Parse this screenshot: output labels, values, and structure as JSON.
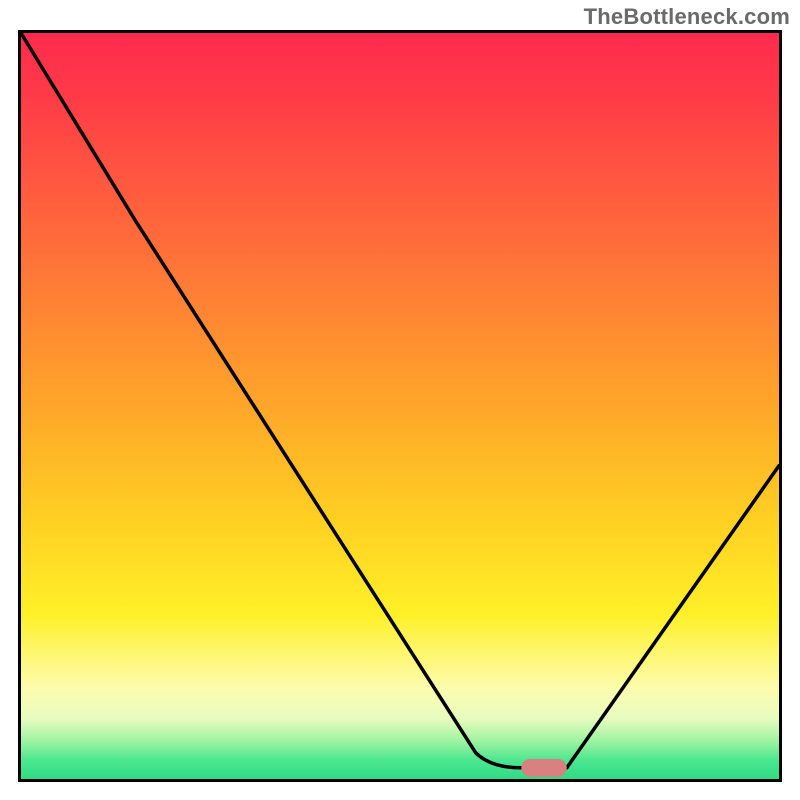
{
  "attribution": "TheBottleneck.com",
  "colors": {
    "frame": "#000000",
    "curve": "#000000",
    "pill": "#d98080",
    "gradient_stops": [
      "#ff2a4d",
      "#ff3a48",
      "#ff5840",
      "#ff7f35",
      "#ffa62a",
      "#ffcf22",
      "#fff028",
      "#fdfcb0",
      "#e6fcbf",
      "#9cf3a0",
      "#4de690",
      "#2fdb85"
    ]
  },
  "chart_data": {
    "type": "line",
    "title": "",
    "xlabel": "",
    "ylabel": "",
    "xlim": [
      0,
      100
    ],
    "ylim": [
      0,
      100
    ],
    "series": [
      {
        "name": "bottleneck-curve",
        "x": [
          0,
          15,
          60,
          66,
          72,
          100
        ],
        "values": [
          100,
          75,
          3.5,
          1.5,
          1.5,
          42
        ]
      }
    ],
    "marker": {
      "name": "optimal-region-pill",
      "x_center": 69,
      "y": 1.5,
      "width_pct": 6,
      "color": "#d98080"
    },
    "background": {
      "type": "vertical-gradient-heatmap",
      "meaning": "bottleneck severity (top=red=high, bottom=green=low)"
    }
  }
}
